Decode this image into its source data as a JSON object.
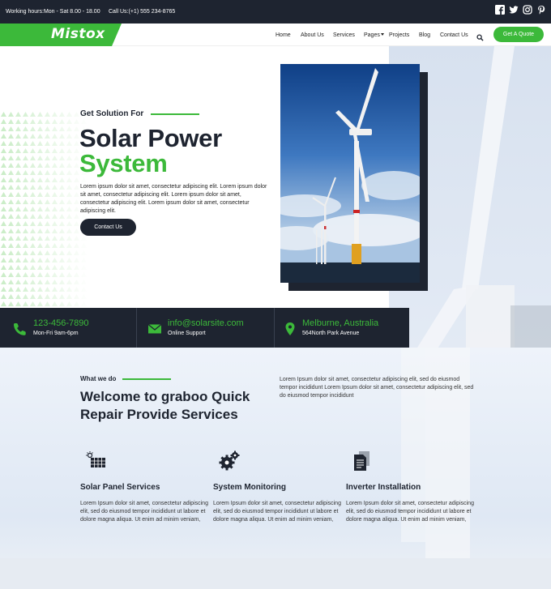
{
  "topbar": {
    "hours": "Working hours:Mon - Sat 8.00 - 18.00",
    "call": "Call Us:(+1) 555 234-8765",
    "social": [
      "facebook-icon",
      "twitter-icon",
      "instagram-icon",
      "pinterest-icon"
    ]
  },
  "nav": {
    "logo": "Mistox",
    "items": [
      "Home",
      "About Us",
      "Services",
      "Pages",
      "Projects",
      "Blog",
      "Contact Us"
    ],
    "quote_label": "Get A Quote"
  },
  "hero": {
    "subtitle": "Get Solution For",
    "title_line1": "Solar Power",
    "title_line2": "System",
    "text": "Lorem ipsum dolor sit amet, consectetur adipiscing elit. Lorem ipsum dolor sit amet, consectetur adipiscing elit. Lorem ipsum dolor sit amet, consectetur adipiscing elit. Lorem ipsum dolor sit amet, consectetur adipiscing elit.",
    "button_label": "Contact Us"
  },
  "contact": [
    {
      "main": "123-456-7890",
      "sub": "Mon-Fri 9am-6pm",
      "icon": "phone-icon"
    },
    {
      "main": "info@solarsite.com",
      "sub": "Online Support",
      "icon": "email-icon"
    },
    {
      "main": "Melburne, Australia",
      "sub": "564North Park Avenue",
      "icon": "location-icon"
    }
  ],
  "about": {
    "label": "What we do",
    "title": "Welcome to graboo Quick Repair Provide Services",
    "text": "Lorem Ipsum dolor sit amet, consectetur adipiscing elit, sed do eiusmod tempor incididunt Lorem Ipsum dolor sit amet, consectetur adipiscing elit, sed do eiusmod tempor incididunt"
  },
  "services": [
    {
      "title": "Solar Panel Services",
      "icon": "solar-panel-icon",
      "text": "Lorem Ipsum dolor sit amet, consectetur adipiscing elit, sed do eiusmod tempor incididunt ut labore et dolore magna aliqua. Ut enim ad minim veniam,"
    },
    {
      "title": "System Monitoring",
      "icon": "gears-icon",
      "text": "Lorem Ipsum dolor sit amet, consectetur adipiscing elit, sed do eiusmod tempor incididunt ut labore et dolore magna aliqua. Ut enim ad minim veniam,"
    },
    {
      "title": "Inverter Installation",
      "icon": "document-icon",
      "text": "Lorem Ipsum dolor sit amet, consectetur adipiscing elit, sed do eiusmod tempor incididunt ut labore et dolore magna aliqua. Ut enim ad minim veniam,"
    }
  ],
  "colors": {
    "accent": "#3cb93a",
    "dark": "#1e2430"
  }
}
